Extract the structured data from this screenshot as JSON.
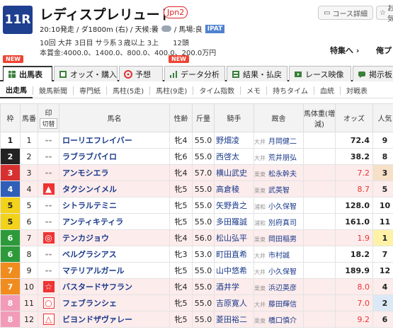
{
  "race": {
    "number": "11R",
    "title": "レディスプレリュード",
    "grade": "Jpn2",
    "info_line1": "20:10発走 / ダ1800m (右) / 天候:曇",
    "weather_icon": "cloud-icon",
    "track_condition": "/ 馬場:良",
    "ipat": "IPAT",
    "info_line2": "10回 大井 3日目 サラ系３歳以上 3上　　12頭",
    "info_line3": "本賞金:4000.0、1400.0、800.0、400.0、200.0万円"
  },
  "header_links": {
    "course_detail": "コース詳細",
    "favorite": "お気",
    "feature": "特集へ ›",
    "recent": "俺プ"
  },
  "tabs": [
    {
      "label": "出馬表",
      "new": true,
      "icon": "table-icon"
    },
    {
      "label": "オッズ・購入",
      "new": false,
      "icon": "odds-icon"
    },
    {
      "label": "予想",
      "new": false,
      "icon": "target-icon"
    },
    {
      "label": "データ分析",
      "new": true,
      "icon": "chart-icon"
    },
    {
      "label": "結果・払戻",
      "new": false,
      "icon": "result-icon"
    },
    {
      "label": "レース映像",
      "new": false,
      "icon": "video-icon"
    },
    {
      "label": "掲示板",
      "new": false,
      "icon": "board-icon"
    }
  ],
  "new_badge": "NEW",
  "subtabs": [
    "出走馬",
    "競馬新聞",
    "専門紙",
    "馬柱(5走)",
    "馬柱(9走)",
    "タイム指数",
    "メモ",
    "持ちタイム",
    "血統",
    "対戦表"
  ],
  "columns": {
    "waku": "枠",
    "umaban": "馬番",
    "mark": "印",
    "mark_sub": "切替",
    "horse": "馬名",
    "sex_age": "性齢",
    "weight": "斤量",
    "jockey": "騎手",
    "trainer": "厩舎",
    "body_weight": "馬体重(増減)",
    "odds": "オッズ",
    "popularity": "人気"
  },
  "waku_colors": {
    "1": "#ffffff",
    "2": "#222222",
    "3": "#d73030",
    "4": "#2f5fb8",
    "5": "#f2d21a",
    "6": "#2d9a3a",
    "7": "#f08c1e",
    "8": "#f29bb8"
  },
  "entries": [
    {
      "waku": "1",
      "no": "1",
      "mark": "--",
      "horse": "ローリエフレイバー",
      "sex_age": "牝4",
      "weight": "55.0",
      "jockey": "野畑凌",
      "area": "大井",
      "trainer": "月岡健二",
      "odds": "72.4",
      "pop": "9",
      "hl": false
    },
    {
      "waku": "2",
      "no": "2",
      "mark": "--",
      "horse": "ラブラブパイロ",
      "sex_age": "牝6",
      "weight": "55.0",
      "jockey": "西啓太",
      "area": "大井",
      "trainer": "荒井朋弘",
      "odds": "38.2",
      "pop": "8",
      "hl": false
    },
    {
      "waku": "3",
      "no": "3",
      "mark": "--",
      "horse": "アンモシエラ",
      "sex_age": "牝4",
      "weight": "57.0",
      "jockey": "横山武史",
      "area": "栗東",
      "trainer": "松永幹夫",
      "odds": "7.2",
      "pop": "3",
      "hl": true
    },
    {
      "waku": "4",
      "no": "4",
      "mark": "▲",
      "horse": "タクシンイメル",
      "sex_age": "牝5",
      "weight": "55.0",
      "jockey": "高倉稜",
      "area": "栗東",
      "trainer": "武英智",
      "odds": "8.7",
      "pop": "5",
      "hl": true
    },
    {
      "waku": "5",
      "no": "5",
      "mark": "--",
      "horse": "シトラルテミニ",
      "sex_age": "牝5",
      "weight": "55.0",
      "jockey": "矢野貴之",
      "area": "浦和",
      "trainer": "小久保智",
      "odds": "128.0",
      "pop": "10",
      "hl": false
    },
    {
      "waku": "5",
      "no": "6",
      "mark": "--",
      "horse": "アンティキティラ",
      "sex_age": "牝5",
      "weight": "55.0",
      "jockey": "多田羅誠",
      "area": "浦和",
      "trainer": "別府真司",
      "odds": "161.0",
      "pop": "11",
      "hl": false
    },
    {
      "waku": "6",
      "no": "7",
      "mark": "◎",
      "horse": "テンカジョウ",
      "sex_age": "牝4",
      "weight": "56.0",
      "jockey": "松山弘平",
      "area": "栗東",
      "trainer": "岡田稲男",
      "odds": "1.9",
      "pop": "1",
      "hl": true
    },
    {
      "waku": "6",
      "no": "8",
      "mark": "--",
      "horse": "ベルグラシアス",
      "sex_age": "牝3",
      "weight": "53.0",
      "jockey": "町田直希",
      "area": "大井",
      "trainer": "市村誠",
      "odds": "18.2",
      "pop": "7",
      "hl": false
    },
    {
      "waku": "7",
      "no": "9",
      "mark": "--",
      "horse": "マテリアルガール",
      "sex_age": "牝5",
      "weight": "55.0",
      "jockey": "山中悠希",
      "area": "大井",
      "trainer": "小久保智",
      "odds": "189.9",
      "pop": "12",
      "hl": false
    },
    {
      "waku": "7",
      "no": "10",
      "mark": "☆",
      "horse": "バスタードサフラン",
      "sex_age": "牝4",
      "weight": "55.0",
      "jockey": "酒井学",
      "area": "栗東",
      "trainer": "浜辺英彦",
      "odds": "8.0",
      "pop": "4",
      "hl": true
    },
    {
      "waku": "8",
      "no": "11",
      "mark": "○",
      "horse": "フェブランシェ",
      "sex_age": "牝5",
      "weight": "55.0",
      "jockey": "吉原寛人",
      "area": "大井",
      "trainer": "藤田輝信",
      "odds": "7.0",
      "pop": "2",
      "hl": true
    },
    {
      "waku": "8",
      "no": "12",
      "mark": "△",
      "horse": "ビヨンドザヴァレー",
      "sex_age": "牝5",
      "weight": "55.0",
      "jockey": "菱田裕二",
      "area": "栗東",
      "trainer": "橋口慎介",
      "odds": "9.2",
      "pop": "6",
      "hl": true
    }
  ]
}
